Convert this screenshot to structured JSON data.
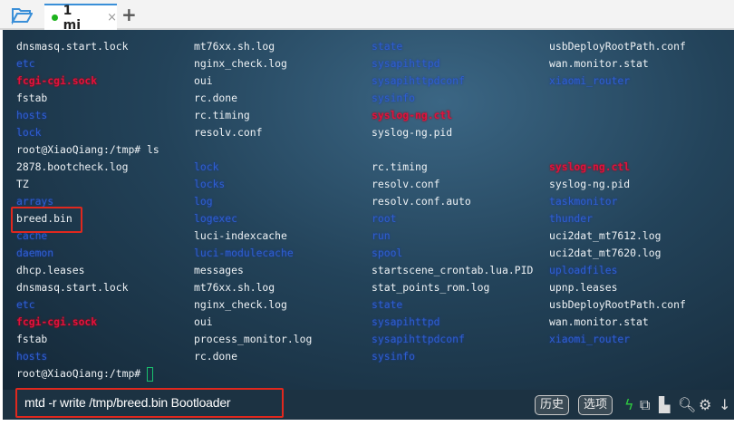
{
  "tabs": {
    "title": "1 mi",
    "close": "×",
    "new_tab": "+"
  },
  "terminal": {
    "rows": [
      [
        [
          "dnsmasq.start.lock",
          "w"
        ],
        [
          "mt76xx.sh.log",
          "w"
        ],
        [
          "state",
          "b"
        ],
        [
          "usbDeployRootPath.conf",
          "w"
        ]
      ],
      [
        [
          "etc",
          "b"
        ],
        [
          "nginx_check.log",
          "w"
        ],
        [
          "sysapihttpd",
          "b"
        ],
        [
          "wan.monitor.stat",
          "w"
        ]
      ],
      [
        [
          "fcgi-cgi.sock",
          "r"
        ],
        [
          "oui",
          "w"
        ],
        [
          "sysapihttpdconf",
          "b"
        ],
        [
          "xiaomi_router",
          "b"
        ]
      ],
      [
        [
          "fstab",
          "w"
        ],
        [
          "rc.done",
          "w"
        ],
        [
          "sysinfo",
          "b"
        ]
      ],
      [
        [
          "hosts",
          "b"
        ],
        [
          "rc.timing",
          "w"
        ],
        [
          "syslog-ng.ctl",
          "r"
        ]
      ],
      [
        [
          "lock",
          "b"
        ],
        [
          "resolv.conf",
          "w"
        ],
        [
          "syslog-ng.pid",
          "w"
        ]
      ],
      "root@XiaoQiang:/tmp# ls",
      [
        [
          "2878.bootcheck.log",
          "w"
        ],
        [
          "lock",
          "b"
        ],
        [
          "rc.timing",
          "w"
        ],
        [
          "syslog-ng.ctl",
          "r"
        ]
      ],
      [
        [
          "TZ",
          "w"
        ],
        [
          "locks",
          "b"
        ],
        [
          "resolv.conf",
          "w"
        ],
        [
          "syslog-ng.pid",
          "w"
        ]
      ],
      [
        [
          "arrays",
          "b"
        ],
        [
          "log",
          "b"
        ],
        [
          "resolv.conf.auto",
          "w"
        ],
        [
          "taskmonitor",
          "b"
        ]
      ],
      [
        [
          "breed.bin",
          "w"
        ],
        [
          "logexec",
          "b"
        ],
        [
          "root",
          "b"
        ],
        [
          "thunder",
          "b"
        ]
      ],
      [
        [
          "cache",
          "b"
        ],
        [
          "luci-indexcache",
          "w"
        ],
        [
          "run",
          "b"
        ],
        [
          "uci2dat_mt7612.log",
          "w"
        ]
      ],
      [
        [
          "daemon",
          "b"
        ],
        [
          "luci-modulecache",
          "b"
        ],
        [
          "spool",
          "b"
        ],
        [
          "uci2dat_mt7620.log",
          "w"
        ]
      ],
      [
        [
          "dhcp.leases",
          "w"
        ],
        [
          "messages",
          "w"
        ],
        [
          "startscene_crontab.lua.PID",
          "w"
        ],
        [
          "uploadfiles",
          "b"
        ]
      ],
      [
        [
          "dnsmasq.start.lock",
          "w"
        ],
        [
          "mt76xx.sh.log",
          "w"
        ],
        [
          "stat_points_rom.log",
          "w"
        ],
        [
          "upnp.leases",
          "w"
        ]
      ],
      [
        [
          "etc",
          "b"
        ],
        [
          "nginx_check.log",
          "w"
        ],
        [
          "state",
          "b"
        ],
        [
          "usbDeployRootPath.conf",
          "w"
        ]
      ],
      [
        [
          "fcgi-cgi.sock",
          "r"
        ],
        [
          "oui",
          "w"
        ],
        [
          "sysapihttpd",
          "b"
        ],
        [
          "wan.monitor.stat",
          "w"
        ]
      ],
      [
        [
          "fstab",
          "w"
        ],
        [
          "process_monitor.log",
          "w"
        ],
        [
          "sysapihttpdconf",
          "b"
        ],
        [
          "xiaomi_router",
          "b"
        ]
      ],
      [
        [
          "hosts",
          "b"
        ],
        [
          "rc.done",
          "w"
        ],
        [
          "sysinfo",
          "b"
        ]
      ]
    ],
    "prompt": "root@XiaoQiang:/tmp# "
  },
  "command_input": {
    "value": "mtd -r write /tmp/breed.bin Bootloader"
  },
  "toolbar": {
    "history": "历史",
    "options": "选项"
  }
}
